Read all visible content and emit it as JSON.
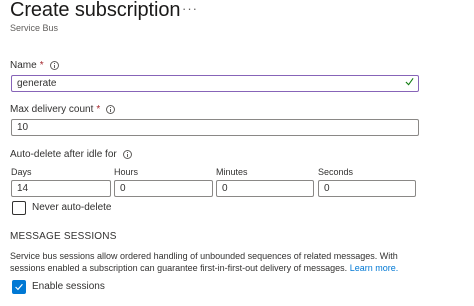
{
  "header": {
    "title": "Create subscription",
    "more_icon": "more-horizontal-icon",
    "subtitle": "Service Bus"
  },
  "form": {
    "name": {
      "label": "Name",
      "required": "*",
      "value": "generate"
    },
    "max_delivery": {
      "label": "Max delivery count",
      "required": "*",
      "value": "10"
    },
    "auto_delete": {
      "label": "Auto-delete after idle for",
      "days": {
        "label": "Days",
        "value": "14"
      },
      "hours": {
        "label": "Hours",
        "value": "0"
      },
      "minutes": {
        "label": "Minutes",
        "value": "0"
      },
      "seconds": {
        "label": "Seconds",
        "value": "0"
      },
      "never_label": "Never auto-delete",
      "never_checked": false
    }
  },
  "sessions": {
    "heading": "MESSAGE SESSIONS",
    "description_line1": "Service bus sessions allow ordered handling of unbounded sequences of related messages. With",
    "description_line2": "sessions enabled a subscription can guarantee first-in-first-out delivery of messages.",
    "learn_more": "Learn more.",
    "enable_label": "Enable sessions",
    "enable_checked": true
  },
  "colors": {
    "accent": "#0078d4",
    "valid_border": "#8764b8",
    "valid_check": "#107c10",
    "required": "#a4262c"
  }
}
